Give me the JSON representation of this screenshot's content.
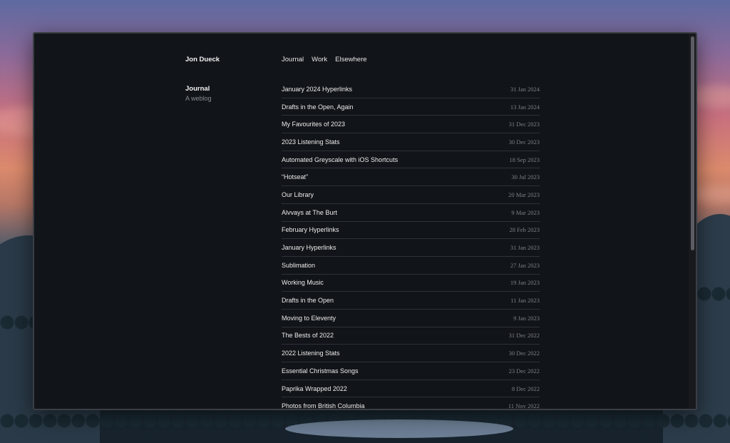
{
  "site": {
    "title": "Jon Dueck"
  },
  "nav": {
    "items": [
      {
        "label": "Journal"
      },
      {
        "label": "Work"
      },
      {
        "label": "Elsewhere"
      }
    ]
  },
  "section": {
    "title": "Journal",
    "subtitle": "A weblog"
  },
  "posts": [
    {
      "title": "January 2024 Hyperlinks",
      "date": "31 Jan 2024"
    },
    {
      "title": "Drafts in the Open, Again",
      "date": "13 Jan 2024"
    },
    {
      "title": "My Favourites of 2023",
      "date": "31 Dec 2023"
    },
    {
      "title": "2023 Listening Stats",
      "date": "30 Dec 2023"
    },
    {
      "title": "Automated Greyscale with iOS Shortcuts",
      "date": "18 Sep 2023"
    },
    {
      "title": "“Hotseat”",
      "date": "30 Jul 2023"
    },
    {
      "title": "Our Library",
      "date": "20 Mar 2023"
    },
    {
      "title": "Alvvays at The Burt",
      "date": "9 Mar 2023"
    },
    {
      "title": "February Hyperlinks",
      "date": "28 Feb 2023"
    },
    {
      "title": "January Hyperlinks",
      "date": "31 Jan 2023"
    },
    {
      "title": "Sublimation",
      "date": "27 Jan 2023"
    },
    {
      "title": "Working Music",
      "date": "19 Jan 2023"
    },
    {
      "title": "Drafts in the Open",
      "date": "11 Jan 2023"
    },
    {
      "title": "Moving to Eleventy",
      "date": "9 Jan 2023"
    },
    {
      "title": "The Bests of 2022",
      "date": "31 Dec 2022"
    },
    {
      "title": "2022 Listening Stats",
      "date": "30 Dec 2022"
    },
    {
      "title": "Essential Christmas Songs",
      "date": "23 Dec 2022"
    },
    {
      "title": "Paprika Wrapped 2022",
      "date": "8 Dec 2022"
    },
    {
      "title": "Photos from British Columbia",
      "date": "11 Nov 2022"
    }
  ],
  "colors": {
    "window_bg": "#111418",
    "text": "#ececec",
    "muted": "#7e8288",
    "divider": "#2e3238"
  }
}
